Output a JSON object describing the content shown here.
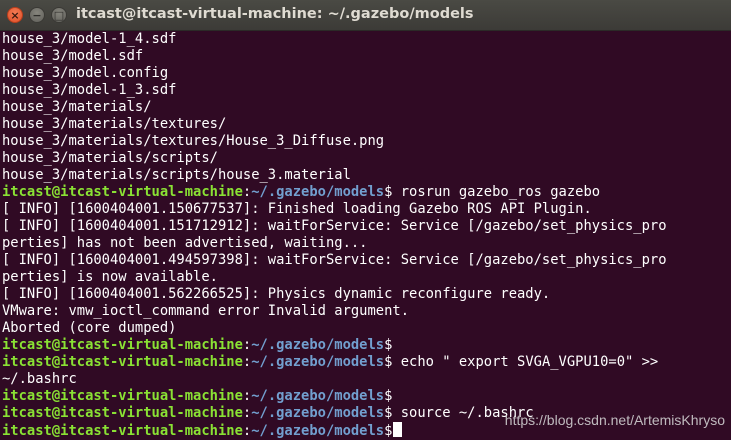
{
  "window": {
    "title": "itcast@itcast-virtual-machine: ~/.gazebo/models",
    "close_glyph": "×",
    "minimize_glyph": "−",
    "maximize_glyph": "□"
  },
  "prompt": {
    "user": "itcast@itcast-virtual-machine",
    "colon": ":",
    "path": "~/.gazebo/models",
    "symbol": "$"
  },
  "colors": {
    "background": "#300a24",
    "text": "#ffffff",
    "prompt_user": "#8ae234",
    "prompt_path": "#729fcf"
  },
  "terminal": {
    "lines": [
      {
        "type": "out",
        "text": "house_3/model-1_4.sdf"
      },
      {
        "type": "out",
        "text": "house_3/model.sdf"
      },
      {
        "type": "out",
        "text": "house_3/model.config"
      },
      {
        "type": "out",
        "text": "house_3/model-1_3.sdf"
      },
      {
        "type": "out",
        "text": "house_3/materials/"
      },
      {
        "type": "out",
        "text": "house_3/materials/textures/"
      },
      {
        "type": "out",
        "text": "house_3/materials/textures/House_3_Diffuse.png"
      },
      {
        "type": "out",
        "text": "house_3/materials/scripts/"
      },
      {
        "type": "out",
        "text": "house_3/materials/scripts/house_3.material"
      },
      {
        "type": "prompt",
        "cmd": " rosrun gazebo_ros gazebo"
      },
      {
        "type": "out",
        "text": "[ INFO] [1600404001.150677537]: Finished loading Gazebo ROS API Plugin."
      },
      {
        "type": "out",
        "text": "[ INFO] [1600404001.151712912]: waitForService: Service [/gazebo/set_physics_pro"
      },
      {
        "type": "out",
        "text": "perties] has not been advertised, waiting..."
      },
      {
        "type": "out",
        "text": "[ INFO] [1600404001.494597398]: waitForService: Service [/gazebo/set_physics_pro"
      },
      {
        "type": "out",
        "text": "perties] is now available."
      },
      {
        "type": "out",
        "text": "[ INFO] [1600404001.562266525]: Physics dynamic reconfigure ready."
      },
      {
        "type": "out",
        "text": "VMware: vmw_ioctl_command error Invalid argument."
      },
      {
        "type": "out",
        "text": "Aborted (core dumped)"
      },
      {
        "type": "prompt",
        "cmd": ""
      },
      {
        "type": "prompt",
        "cmd": " echo \" export SVGA_VGPU10=0\" >>"
      },
      {
        "type": "out",
        "text": "~/.bashrc"
      },
      {
        "type": "prompt",
        "cmd": ""
      },
      {
        "type": "prompt",
        "cmd": " source ~/.bashrc"
      },
      {
        "type": "prompt",
        "cmd": "",
        "cursor": true
      }
    ]
  },
  "watermark": "https://blog.csdn.net/ArtemisKhryso"
}
